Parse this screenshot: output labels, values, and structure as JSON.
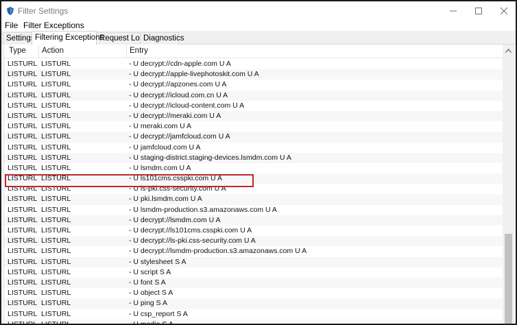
{
  "window": {
    "title": "Filter Settings",
    "controls": [
      "minimize",
      "maximize",
      "close"
    ]
  },
  "menu": {
    "items": [
      "File",
      "Filter Exceptions"
    ]
  },
  "tabs": [
    {
      "label": "Settings",
      "active": false
    },
    {
      "label": "Filtering Exceptions",
      "active": true
    },
    {
      "label": "Request Logs",
      "active": false
    },
    {
      "label": "Diagnostics",
      "active": false
    }
  ],
  "table": {
    "columns": [
      "Type",
      "Action",
      "Entry"
    ],
    "rows": [
      {
        "type": "LISTURL",
        "action": "LISTURL",
        "entry": "- U decrypt://cdn-apple.com U A"
      },
      {
        "type": "LISTURL",
        "action": "LISTURL",
        "entry": "- U decrypt://apple-livephotoskit.com U A"
      },
      {
        "type": "LISTURL",
        "action": "LISTURL",
        "entry": "- U decrypt://apzones.com U A"
      },
      {
        "type": "LISTURL",
        "action": "LISTURL",
        "entry": "- U decrypt://icloud.com.cn U A"
      },
      {
        "type": "LISTURL",
        "action": "LISTURL",
        "entry": "- U decrypt://icloud-content.com U A"
      },
      {
        "type": "LISTURL",
        "action": "LISTURL",
        "entry": "- U decrypt://meraki.com U A"
      },
      {
        "type": "LISTURL",
        "action": "LISTURL",
        "entry": "- U meraki.com U A"
      },
      {
        "type": "LISTURL",
        "action": "LISTURL",
        "entry": "- U decrypt://jamfcloud.com U A",
        "highlighted": true
      },
      {
        "type": "LISTURL",
        "action": "LISTURL",
        "entry": "- U jamfcloud.com U A"
      },
      {
        "type": "LISTURL",
        "action": "LISTURL",
        "entry": "- U staging-district.staging-devices.lsmdm.com U A"
      },
      {
        "type": "LISTURL",
        "action": "LISTURL",
        "entry": "- U lsmdm.com U A"
      },
      {
        "type": "LISTURL",
        "action": "LISTURL",
        "entry": "- U ls101cms.csspki.com U A"
      },
      {
        "type": "LISTURL",
        "action": "LISTURL",
        "entry": "- U ls-pki.css-security.com U A"
      },
      {
        "type": "LISTURL",
        "action": "LISTURL",
        "entry": "- U pki.lsmdm.com U A"
      },
      {
        "type": "LISTURL",
        "action": "LISTURL",
        "entry": "- U lsmdm-production.s3.amazonaws.com U A"
      },
      {
        "type": "LISTURL",
        "action": "LISTURL",
        "entry": "- U decrypt://lsmdm.com U A"
      },
      {
        "type": "LISTURL",
        "action": "LISTURL",
        "entry": "- U decrypt://ls101cms.csspki.com U A"
      },
      {
        "type": "LISTURL",
        "action": "LISTURL",
        "entry": "- U decrypt://ls-pki.css-security.com U A"
      },
      {
        "type": "LISTURL",
        "action": "LISTURL",
        "entry": "- U decrypt://lsmdm-production.s3.amazonaws.com U A"
      },
      {
        "type": "LISTURL",
        "action": "LISTURL",
        "entry": "- U stylesheet S A"
      },
      {
        "type": "LISTURL",
        "action": "LISTURL",
        "entry": "- U script S A"
      },
      {
        "type": "LISTURL",
        "action": "LISTURL",
        "entry": "- U font S A"
      },
      {
        "type": "LISTURL",
        "action": "LISTURL",
        "entry": "- U object S A"
      },
      {
        "type": "LISTURL",
        "action": "LISTURL",
        "entry": "- U ping S A"
      },
      {
        "type": "LISTURL",
        "action": "LISTURL",
        "entry": "- U csp_report S A"
      },
      {
        "type": "LISTURL",
        "action": "LISTURL",
        "entry": "- U media S A"
      }
    ]
  },
  "colors": {
    "highlight_border": "#c0262d",
    "app_icon": "#1f5fa8"
  }
}
